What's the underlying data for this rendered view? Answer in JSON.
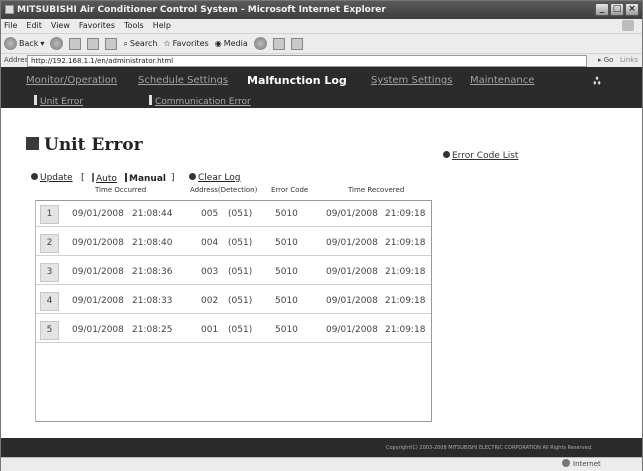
{
  "window": {
    "title": "MITSUBISHI Air Conditioner Control System - Microsoft Internet Explorer"
  },
  "menu": [
    "File",
    "Edit",
    "View",
    "Favorites",
    "Tools",
    "Help"
  ],
  "toolbar": {
    "back": "Back",
    "search": "Search",
    "favorites": "Favorites",
    "media": "Media"
  },
  "address": {
    "label": "Address",
    "url": "http://192.168.1.1/en/administrator.html",
    "go": "Go",
    "links": "Links"
  },
  "nav": {
    "tabs": [
      "Monitor/Operation",
      "Schedule Settings",
      "Malfunction Log",
      "System Settings",
      "Maintenance"
    ],
    "active": "Malfunction Log",
    "sub": [
      "Unit Error",
      "Communication Error"
    ],
    "logo_text": "MITSUBISHI ELECTRIC"
  },
  "page": {
    "title": "Unit Error",
    "error_code_list": "Error Code List",
    "update": "Update",
    "open_bracket": "[",
    "auto": "Auto",
    "manual": "Manual",
    "close_bracket": "]",
    "clear_log": "Clear Log"
  },
  "columns": {
    "time_occurred": "Time Occurred",
    "address": "Address(Detection)",
    "error_code": "Error Code",
    "time_recovered": "Time Recovered"
  },
  "rows": [
    {
      "n": "1",
      "occ_date": "09/01/2008",
      "occ_time": "21:08:44",
      "addr": "005",
      "det": "(051)",
      "code": "5010",
      "rec_date": "09/01/2008",
      "rec_time": "21:09:18"
    },
    {
      "n": "2",
      "occ_date": "09/01/2008",
      "occ_time": "21:08:40",
      "addr": "004",
      "det": "(051)",
      "code": "5010",
      "rec_date": "09/01/2008",
      "rec_time": "21:09:18"
    },
    {
      "n": "3",
      "occ_date": "09/01/2008",
      "occ_time": "21:08:36",
      "addr": "003",
      "det": "(051)",
      "code": "5010",
      "rec_date": "09/01/2008",
      "rec_time": "21:09:18"
    },
    {
      "n": "4",
      "occ_date": "09/01/2008",
      "occ_time": "21:08:33",
      "addr": "002",
      "det": "(051)",
      "code": "5010",
      "rec_date": "09/01/2008",
      "rec_time": "21:09:18"
    },
    {
      "n": "5",
      "occ_date": "09/01/2008",
      "occ_time": "21:08:25",
      "addr": "001",
      "det": "(051)",
      "code": "5010",
      "rec_date": "09/01/2008",
      "rec_time": "21:09:18"
    }
  ],
  "footer": {
    "copyright": "Copyright(C) 2003-2008 MITSUBISHI ELECTRIC CORPORATION All Rights Reserved."
  },
  "status": {
    "left": "",
    "zone": "Internet"
  },
  "icons": {
    "window_icon": "ie-window-icon",
    "back": "back-arrow-icon",
    "forward": "forward-arrow-icon",
    "stop": "stop-icon",
    "refresh": "refresh-icon",
    "home": "home-icon",
    "search": "search-icon",
    "favorites": "star-icon",
    "media": "media-icon",
    "history": "history-icon",
    "mail": "mail-icon",
    "print": "print-icon"
  },
  "colors": {
    "nav_bg": "#2b2b2b",
    "nav_active": "#ffffff",
    "nav_inactive": "#a0a0a0"
  }
}
